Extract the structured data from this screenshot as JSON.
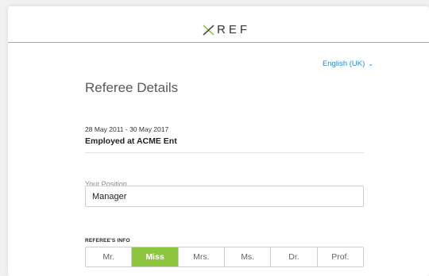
{
  "brand": {
    "logo_text": "REF",
    "accent_color": "#8dc63f",
    "icon": "x-logo-icon"
  },
  "language": {
    "label": "English (UK)",
    "icon": "chevron-down-icon"
  },
  "page": {
    "title": "Referee Details"
  },
  "employment": {
    "date_range": "28 May 2011 - 30 May 2017",
    "employer": "Employed at ACME Ent"
  },
  "position": {
    "label": "Your Position",
    "value": "Manager"
  },
  "referee_info": {
    "section_label": "REFEREE'S INFO",
    "titles": [
      "Mr.",
      "Miss",
      "Mrs.",
      "Ms.",
      "Dr.",
      "Prof."
    ],
    "selected": "Miss"
  }
}
